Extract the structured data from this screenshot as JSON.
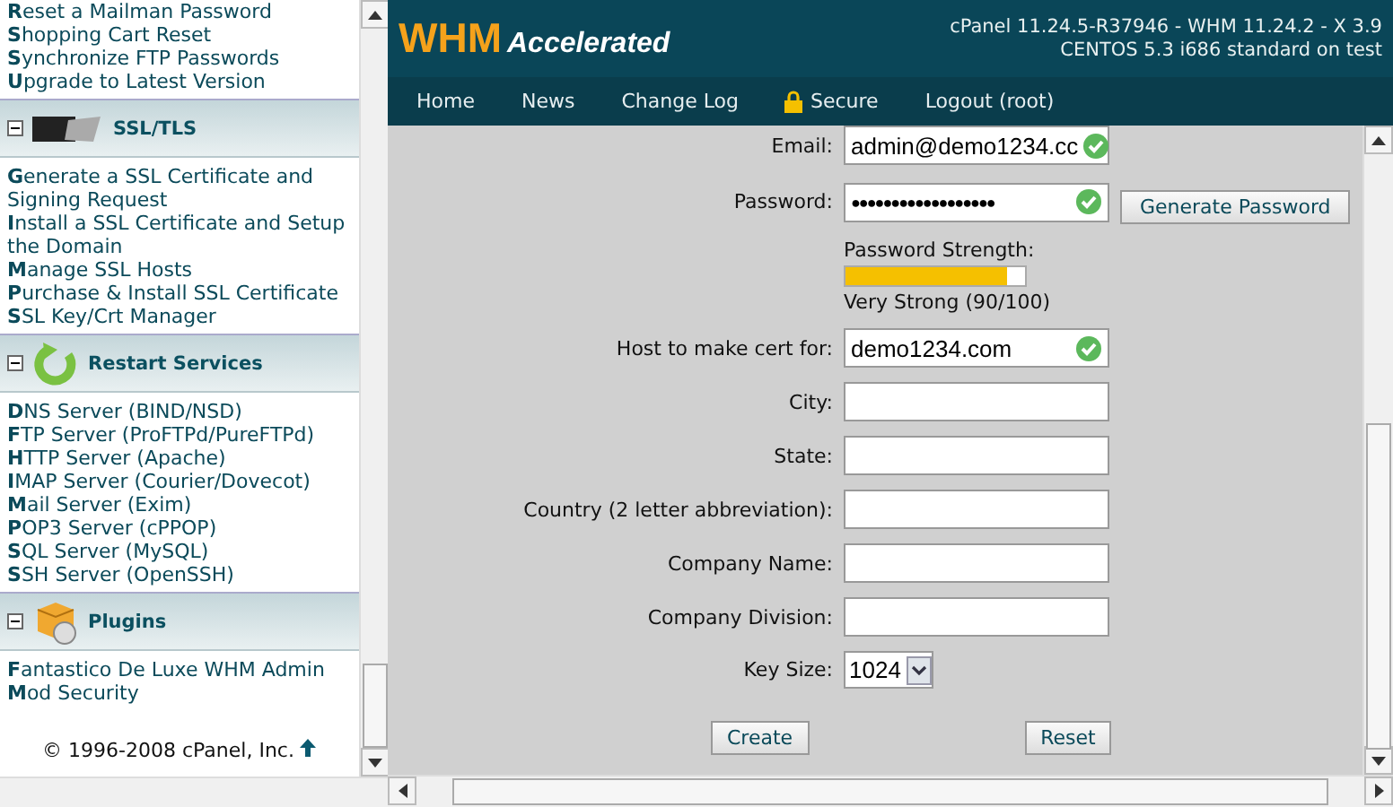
{
  "sidebar": {
    "top_links": [
      "**R**eset a Mailman Password",
      "**S**hopping Cart Reset",
      "**S**ynchronize FTP Passwords",
      "**U**pgrade to Latest Version"
    ],
    "sections": [
      {
        "kind": "ssl",
        "title": "SSL/TLS",
        "expanded": true,
        "links": [
          "**G**enerate a SSL Certificate and Signing Request",
          "**I**nstall a SSL Certificate and Setup the Domain",
          "**M**anage SSL Hosts",
          "**P**urchase & Install SSL Certificate",
          "**S**SL Key/Crt Manager"
        ]
      },
      {
        "kind": "restart",
        "title": "Restart Services",
        "expanded": true,
        "links": [
          "**D**NS Server (BIND/NSD)",
          "**F**TP Server (ProFTPd/PureFTPd)",
          "**H**TTP Server (Apache)",
          "**I**MAP Server (Courier/Dovecot)",
          "**M**ail Server (Exim)",
          "**P**OP3 Server (cPPOP)",
          "**S**QL Server (MySQL)",
          "**S**SH Server (OpenSSH)"
        ]
      },
      {
        "kind": "plugins",
        "title": "Plugins",
        "expanded": true,
        "links": [
          "**F**antastico De Luxe WHM Admin",
          "**M**od Security"
        ]
      }
    ],
    "footer": "© 1996-2008 cPanel, Inc."
  },
  "header": {
    "logo_main": "WHM",
    "logo_sub": "Accelerated",
    "version_line": "cPanel 11.24.5-R37946 - WHM 11.24.2 - X 3.9",
    "os_line": "CENTOS 5.3 i686 standard on test"
  },
  "nav": [
    {
      "label": "Home",
      "kind": "link"
    },
    {
      "label": "News",
      "kind": "link"
    },
    {
      "label": "Change Log",
      "kind": "link"
    },
    {
      "label": "Secure",
      "kind": "lock"
    },
    {
      "label": "Logout (root)",
      "kind": "link"
    }
  ],
  "form": {
    "rows": [
      {
        "kind": "text",
        "label": "Email:",
        "value": "admin@demo1234.cc",
        "valid": true
      },
      {
        "kind": "password",
        "label": "Password:",
        "value": "●●●●●●●●●●●●●●●●●●",
        "valid": true,
        "button": "Generate Password"
      },
      {
        "kind": "strength",
        "title": "Password Strength:",
        "level": 0.9,
        "reading": "Very Strong (90/100)"
      },
      {
        "kind": "text",
        "label": "Host to make cert for:",
        "value": "demo1234.com",
        "valid": true
      },
      {
        "kind": "text",
        "label": "City:",
        "valid": false
      },
      {
        "kind": "text",
        "label": "State:",
        "valid": false
      },
      {
        "kind": "text",
        "label": "Country (2 letter abbreviation):",
        "valid": false
      },
      {
        "kind": "text",
        "label": "Company Name:",
        "valid": false
      },
      {
        "kind": "text",
        "label": "Company Division:",
        "valid": false
      },
      {
        "kind": "select",
        "label": "Key Size:",
        "value": "1024"
      }
    ],
    "buttons": [
      "Create",
      "Reset"
    ]
  }
}
